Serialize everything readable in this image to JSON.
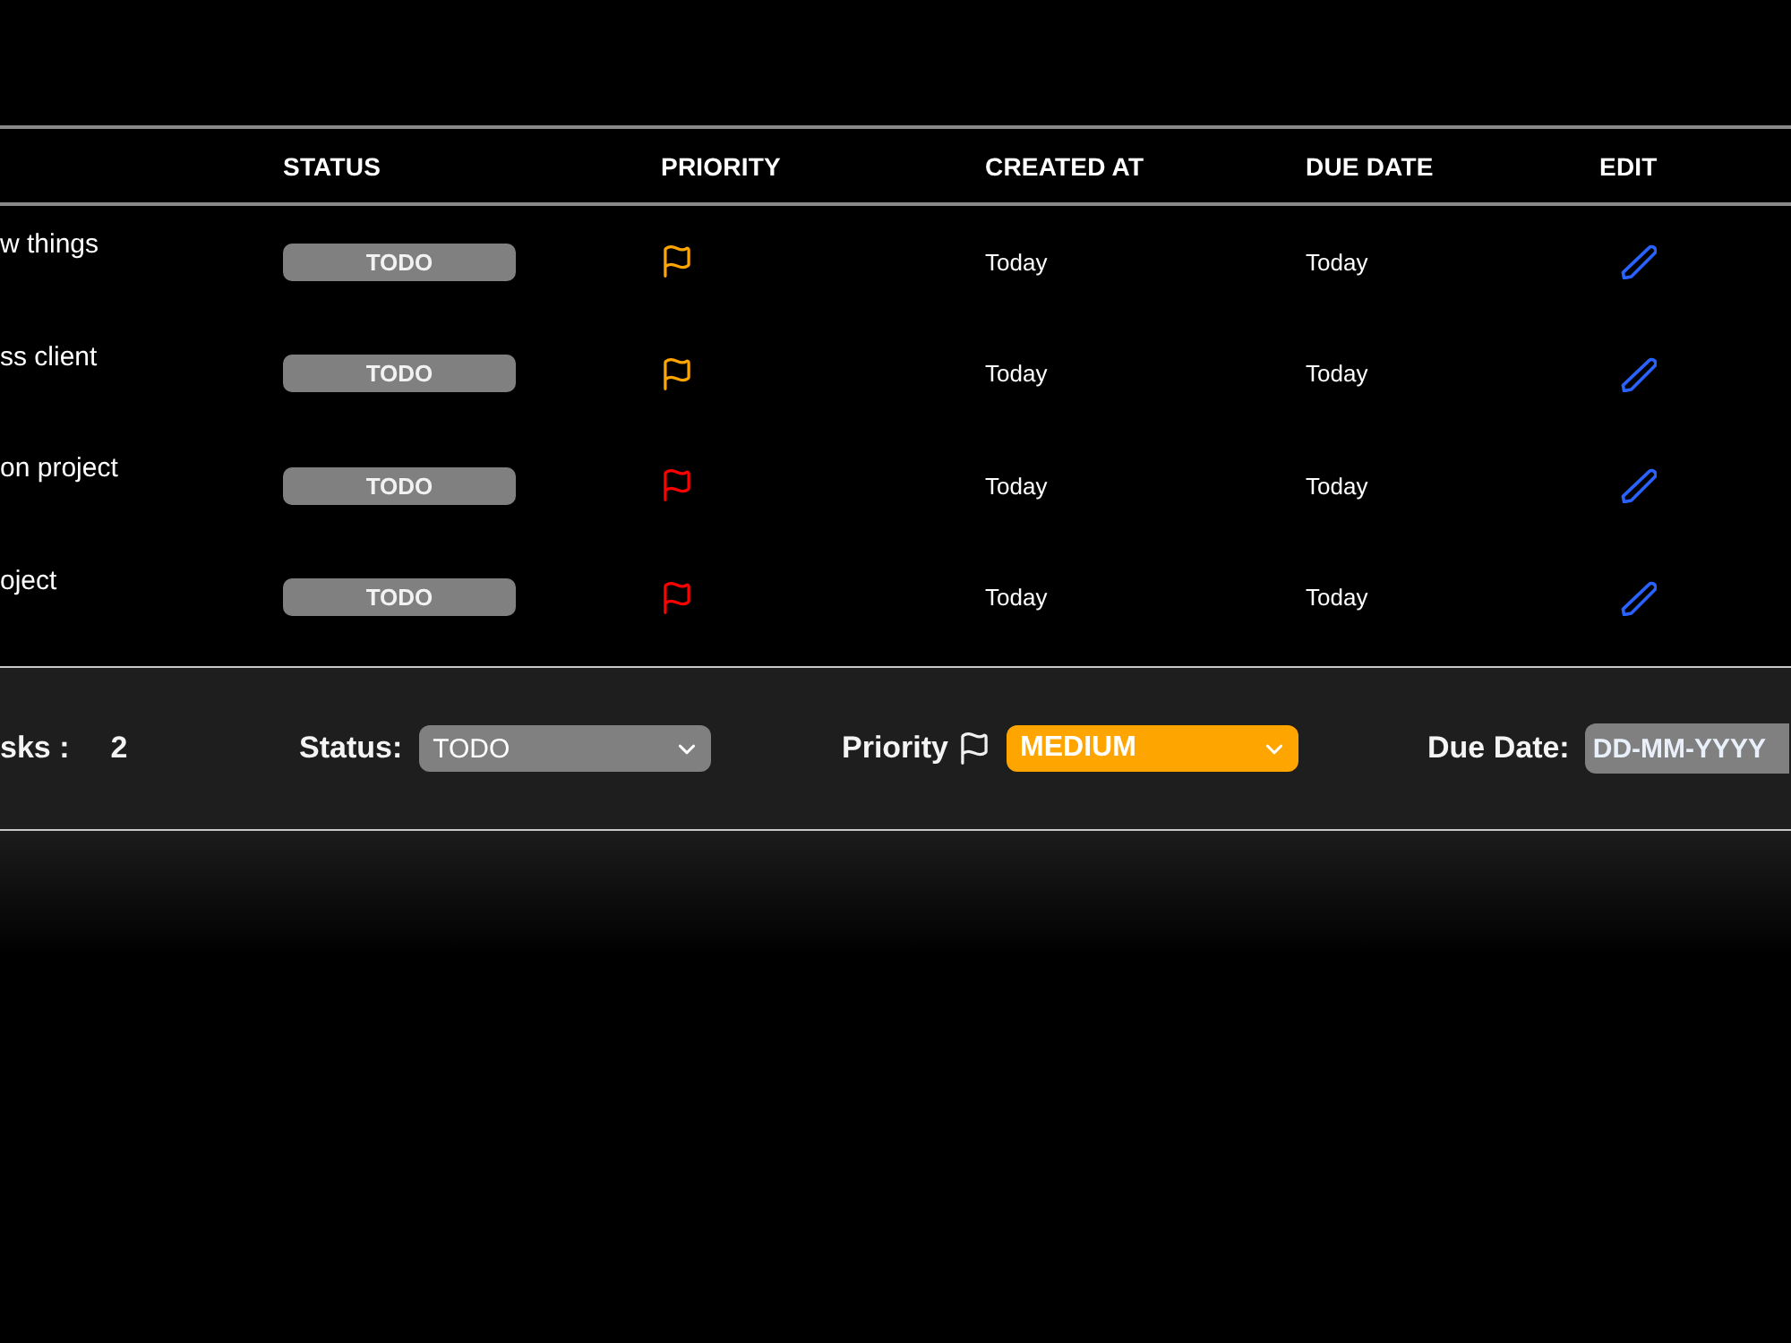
{
  "table": {
    "columns": [
      "STATUS",
      "PRIORITY",
      "CREATED AT",
      "DUE DATE",
      "EDIT"
    ],
    "rows": [
      {
        "title": "w things",
        "status": "TODO",
        "priority_flag": {
          "color": "#ffa500"
        },
        "created_at": "Today",
        "due_date": "Today"
      },
      {
        "title": "ss client",
        "status": "TODO",
        "priority_flag": {
          "color": "#ffa500"
        },
        "created_at": "Today",
        "due_date": "Today"
      },
      {
        "title": "on project",
        "status": "TODO",
        "priority_flag": {
          "color": "#ff0000"
        },
        "created_at": "Today",
        "due_date": "Today"
      },
      {
        "title": "oject",
        "status": "TODO",
        "priority_flag": {
          "color": "#ff0000"
        },
        "created_at": "Today",
        "due_date": "Today"
      }
    ]
  },
  "footer": {
    "tasks_label": "sks :",
    "tasks_count": "2",
    "status_filter": {
      "label": "Status:",
      "value": "TODO"
    },
    "priority_filter": {
      "label": "Priority",
      "value": "MEDIUM"
    },
    "due_date_filter": {
      "label": "Due Date:",
      "placeholder": "DD-MM-YYYY"
    }
  }
}
